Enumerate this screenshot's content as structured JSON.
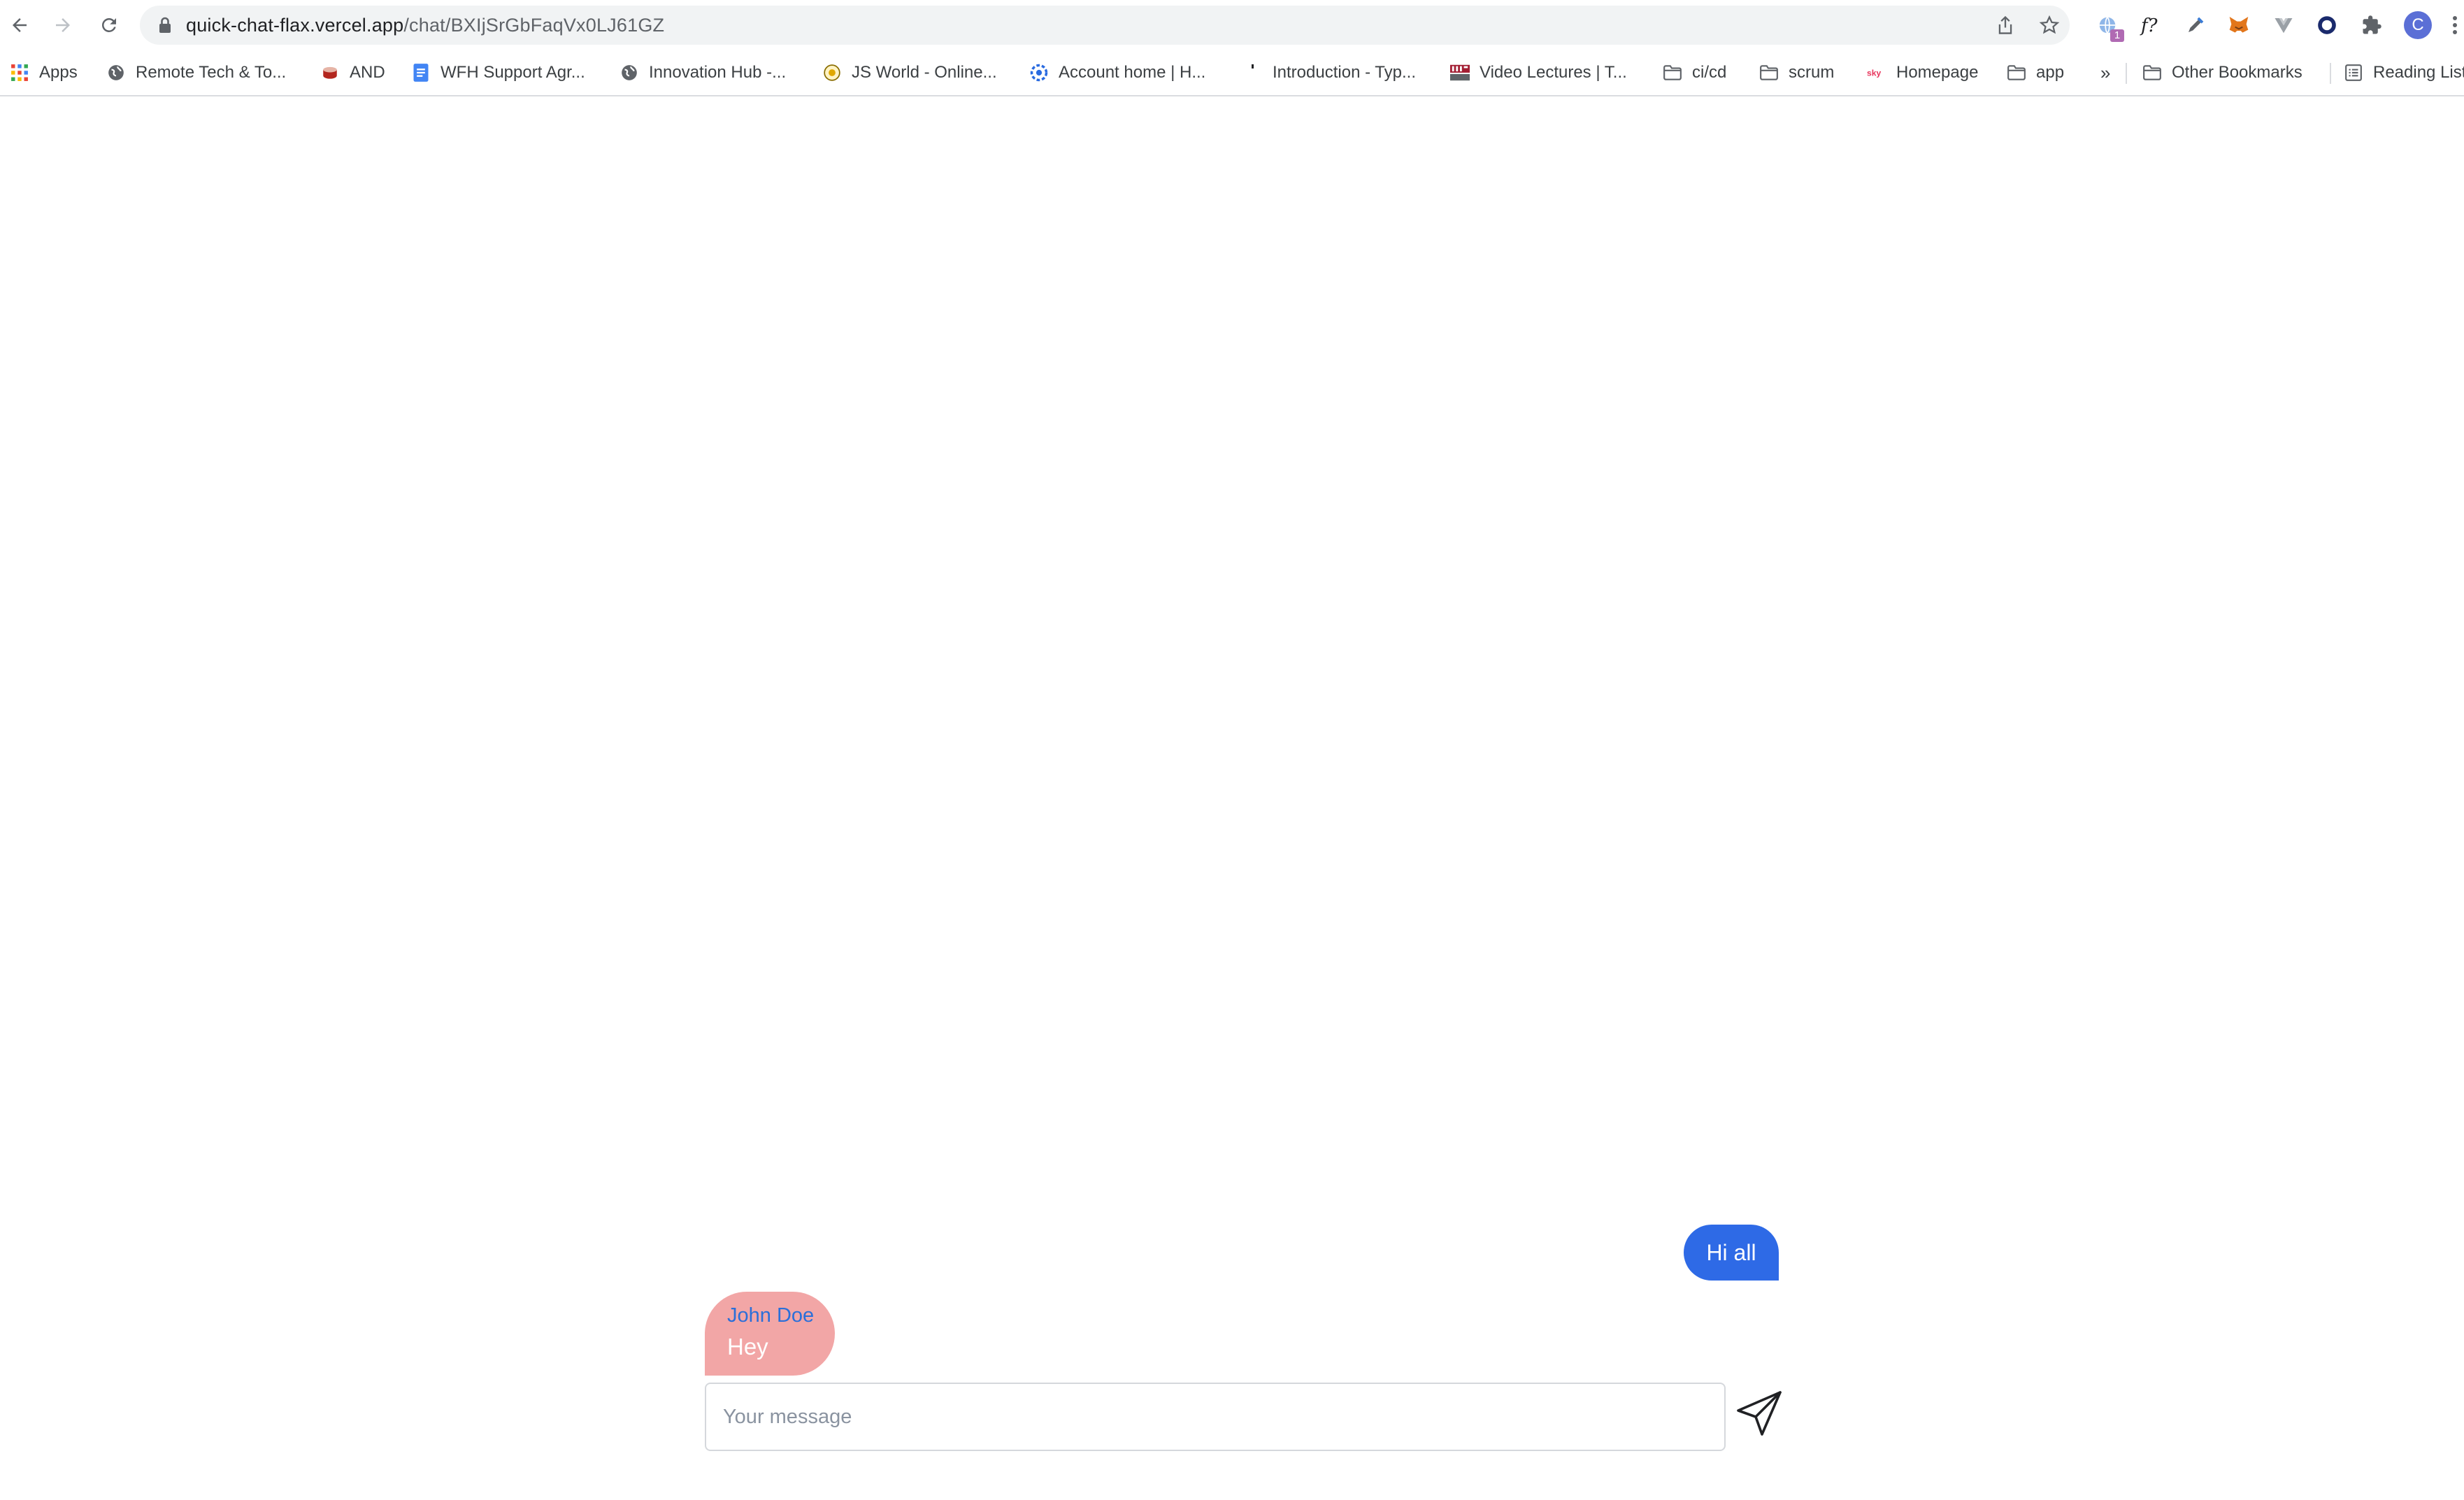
{
  "browser": {
    "url_host": "quick-chat-flax.vercel.app",
    "url_path": "/chat/BXIjSrGbFaqVx0LJ61GZ",
    "extension_badge": "1",
    "profile_initial": "C",
    "more_bookmarks": "»"
  },
  "bookmarks": [
    {
      "label": "Apps",
      "icon": "apps-grid-icon"
    },
    {
      "label": "Remote Tech & To...",
      "icon": "globe-icon"
    },
    {
      "label": "AND",
      "icon": "drum-icon"
    },
    {
      "label": "WFH Support Agr...",
      "icon": "doc-icon"
    },
    {
      "label": "Innovation Hub -...",
      "icon": "globe-icon"
    },
    {
      "label": "JS World - Online...",
      "icon": "js-world-icon"
    },
    {
      "label": "Account home | H...",
      "icon": "swirl-icon"
    },
    {
      "label": "Introduction - Typ...",
      "icon": "blank-icon"
    },
    {
      "label": "Video Lectures | T...",
      "icon": "mit-icon"
    },
    {
      "label": "ci/cd",
      "icon": "folder-icon"
    },
    {
      "label": "scrum",
      "icon": "folder-icon"
    },
    {
      "label": "Homepage",
      "icon": "sky-icon"
    },
    {
      "label": "app",
      "icon": "folder-icon"
    }
  ],
  "other_bookmarks": "Other Bookmarks",
  "reading_list": "Reading List",
  "chat": {
    "messages": [
      {
        "direction": "outgoing",
        "text": "Hi all"
      },
      {
        "direction": "incoming",
        "sender": "John Doe",
        "text": "Hey"
      }
    ],
    "input_placeholder": "Your message"
  },
  "colors": {
    "outgoing_bubble": "#2e6ae6",
    "incoming_bubble": "#f2a6a6",
    "sender_name": "#2b6fd9"
  }
}
